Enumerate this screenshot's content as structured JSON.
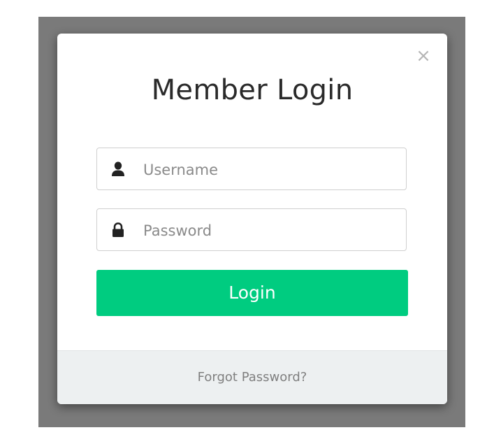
{
  "modal": {
    "title": "Member Login",
    "close_icon": "close-icon",
    "close_symbol": "×"
  },
  "form": {
    "username": {
      "icon": "user-icon",
      "placeholder": "Username",
      "value": ""
    },
    "password": {
      "icon": "lock-icon",
      "placeholder": "Password",
      "value": ""
    },
    "login_label": "Login"
  },
  "footer": {
    "forgot_label": "Forgot Password?"
  },
  "colors": {
    "accent": "#00cc80",
    "backdrop": "#7a7a7a",
    "footer_bg": "#edf0f1"
  }
}
